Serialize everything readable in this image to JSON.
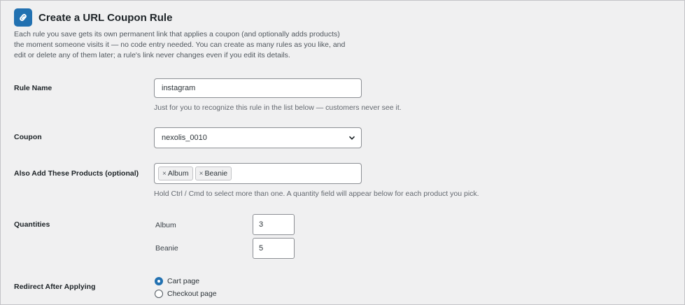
{
  "header": {
    "title": "Create a URL Coupon Rule",
    "intro": "Each rule you save gets its own permanent link that applies a coupon (and optionally adds products) the moment someone visits it — no code entry needed. You can create as many rules as you like, and edit or delete any of them later; a rule's link never changes even if you edit its details.",
    "icon": "link-icon"
  },
  "rule_name": {
    "label": "Rule Name",
    "value": "instagram",
    "description": "Just for you to recognize this rule in the list below — customers never see it."
  },
  "coupon": {
    "label": "Coupon",
    "selected": "nexolis_0010"
  },
  "products": {
    "label": "Also Add These Products (optional)",
    "chips": [
      "Album",
      "Beanie"
    ],
    "description": "Hold Ctrl / Cmd to select more than one. A quantity field will appear below for each product you pick."
  },
  "quantities": {
    "label": "Quantities",
    "items": [
      {
        "name": "Album",
        "value": "3"
      },
      {
        "name": "Beanie",
        "value": "5"
      }
    ]
  },
  "redirect": {
    "label": "Redirect After Applying",
    "options": [
      {
        "label": "Cart page",
        "checked": true
      },
      {
        "label": "Checkout page",
        "checked": false
      }
    ]
  },
  "colors": {
    "accent": "#2271b1",
    "background": "#f0f0f1"
  }
}
